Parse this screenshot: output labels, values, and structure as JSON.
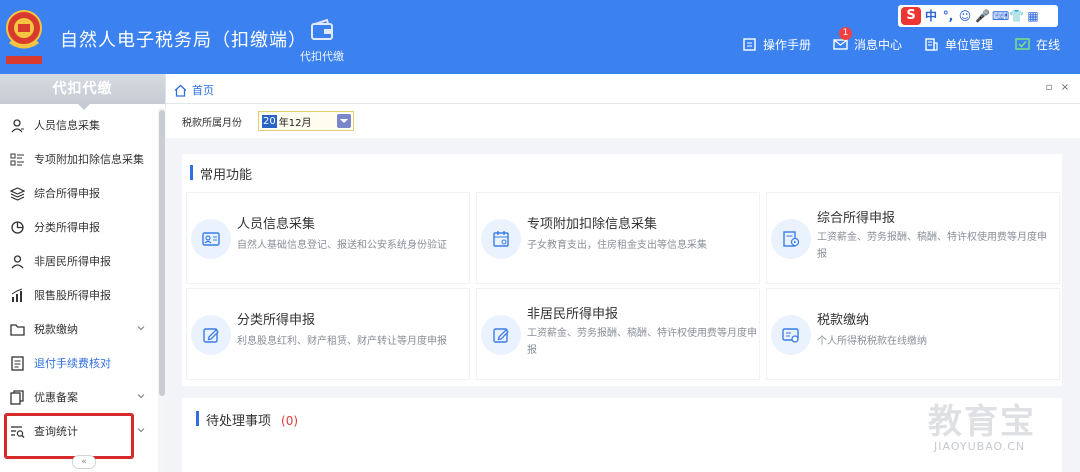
{
  "header": {
    "title": "自然人电子税务局（扣缴端）",
    "module_label": "代扣代缴",
    "ime": {
      "logo": "S",
      "items": [
        "中",
        "°,",
        "☺",
        "🎤",
        "⌨",
        "👕",
        "▦"
      ]
    },
    "links": [
      {
        "label": "操作手册",
        "icon": "book-icon"
      },
      {
        "label": "消息中心",
        "icon": "mail-icon",
        "badge": "1"
      },
      {
        "label": "单位管理",
        "icon": "building-icon"
      },
      {
        "label": "在线",
        "icon": "online-icon"
      }
    ]
  },
  "sidebar": {
    "heading": "代扣代缴",
    "items": [
      {
        "label": "人员信息采集",
        "icon": "person-icon"
      },
      {
        "label": "专项附加扣除信息采集",
        "icon": "list-icon"
      },
      {
        "label": "综合所得申报",
        "icon": "layers-icon"
      },
      {
        "label": "分类所得申报",
        "icon": "pie-icon"
      },
      {
        "label": "非居民所得申报",
        "icon": "person-outline-icon"
      },
      {
        "label": "限售股所得申报",
        "icon": "bar-chart-icon"
      },
      {
        "label": "税款缴纳",
        "icon": "folder-icon",
        "expandable": true
      },
      {
        "label": "退付手续费核对",
        "icon": "document-icon",
        "highlighted": true
      },
      {
        "label": "优惠备案",
        "icon": "copy-icon",
        "expandable": true
      },
      {
        "label": "查询统计",
        "icon": "search-list-icon",
        "expandable": true
      }
    ],
    "collapse_label": "«"
  },
  "tabs": {
    "home": "首页",
    "restore": "▫",
    "close": "×"
  },
  "filter": {
    "label": "税款所属月份",
    "year_selected": "20",
    "month_rest": "  年12月"
  },
  "common": {
    "title": "常用功能",
    "cards": [
      {
        "title": "人员信息采集",
        "desc": "自然人基础信息登记、报送和公安系统身份验证",
        "icon": "id-card-icon"
      },
      {
        "title": "专项附加扣除信息采集",
        "desc": "子女教育支出，住房租金支出等信息采集",
        "icon": "calendar-icon"
      },
      {
        "title": "综合所得申报",
        "desc": "工资薪金、劳务报酬、稿酬、特许权使用费等月度申报",
        "icon": "doc-play-icon"
      },
      {
        "title": "分类所得申报",
        "desc": "利息股息红利、财产租赁、财产转让等月度申报",
        "icon": "edit-icon"
      },
      {
        "title": "非居民所得申报",
        "desc": "工资薪金、劳务报酬、稿酬、特许权使用费等月度申报",
        "icon": "edit-icon"
      },
      {
        "title": "税款缴纳",
        "desc": "个人所得税税款在线缴纳",
        "icon": "payment-icon"
      }
    ]
  },
  "pending": {
    "title": "待处理事项",
    "count": "(0)"
  },
  "watermark": {
    "cn": "教育宝",
    "en": "JIAOYUBAO.CN"
  },
  "colors": {
    "header": "#3b82f0",
    "accent": "#2f6fe0",
    "highlight_border": "#d62a2a",
    "badge": "#f04040"
  }
}
